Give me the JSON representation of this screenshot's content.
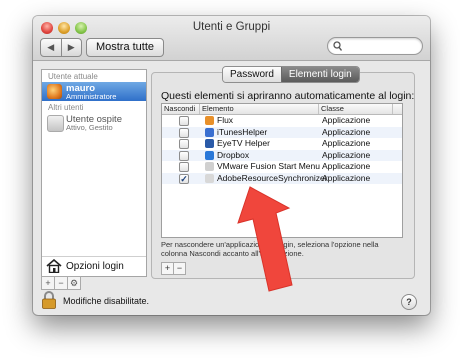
{
  "window": {
    "title": "Utenti e Gruppi"
  },
  "toolbar": {
    "back_icon": "chevron-left-icon",
    "forward_icon": "chevron-right-icon",
    "show_all_label": "Mostra tutte",
    "search_placeholder": ""
  },
  "sidebar": {
    "current_header": "Utente attuale",
    "current_user": {
      "name": "mauro",
      "role": "Amministratore"
    },
    "others_header": "Altri utenti",
    "other_users": [
      {
        "name": "Utente ospite",
        "role": "Attivo, Gestito"
      }
    ],
    "login_options_label": "Opzioni login",
    "tools": [
      "+",
      "−",
      "⚙"
    ]
  },
  "tabs": [
    {
      "label": "Password",
      "active": false
    },
    {
      "label": "Elementi login",
      "active": true
    }
  ],
  "login_items": {
    "heading": "Questi elementi si apriranno automaticamente al login:",
    "columns": {
      "hide": "Nascondi",
      "item": "Elemento",
      "kind": "Classe"
    },
    "rows": [
      {
        "hidden": false,
        "name": "Flux",
        "kind": "Applicazione",
        "icon_color": "#e8902a"
      },
      {
        "hidden": false,
        "name": "iTunesHelper",
        "kind": "Applicazione",
        "icon_color": "#3a6fd0"
      },
      {
        "hidden": false,
        "name": "EyeTV Helper",
        "kind": "Applicazione",
        "icon_color": "#2a5aa8"
      },
      {
        "hidden": false,
        "name": "Dropbox",
        "kind": "Applicazione",
        "icon_color": "#2a78d8"
      },
      {
        "hidden": false,
        "name": "VMware Fusion Start Menu",
        "kind": "Applicazione",
        "icon_color": "#d0d0d0"
      },
      {
        "hidden": true,
        "name": "AdobeResourceSynchronizer",
        "kind": "Applicazione",
        "icon_color": "#d8d8d8"
      }
    ],
    "hint": "Per nascondere un'applicazione al login, seleziona l'opzione nella colonna Nascondi accanto all'applicazione.",
    "add_label": "+",
    "remove_label": "−"
  },
  "footer": {
    "lock_label": "Modifiche disabilitate.",
    "help_label": "?"
  },
  "annotation": {
    "arrow_color": "#f0463c"
  }
}
